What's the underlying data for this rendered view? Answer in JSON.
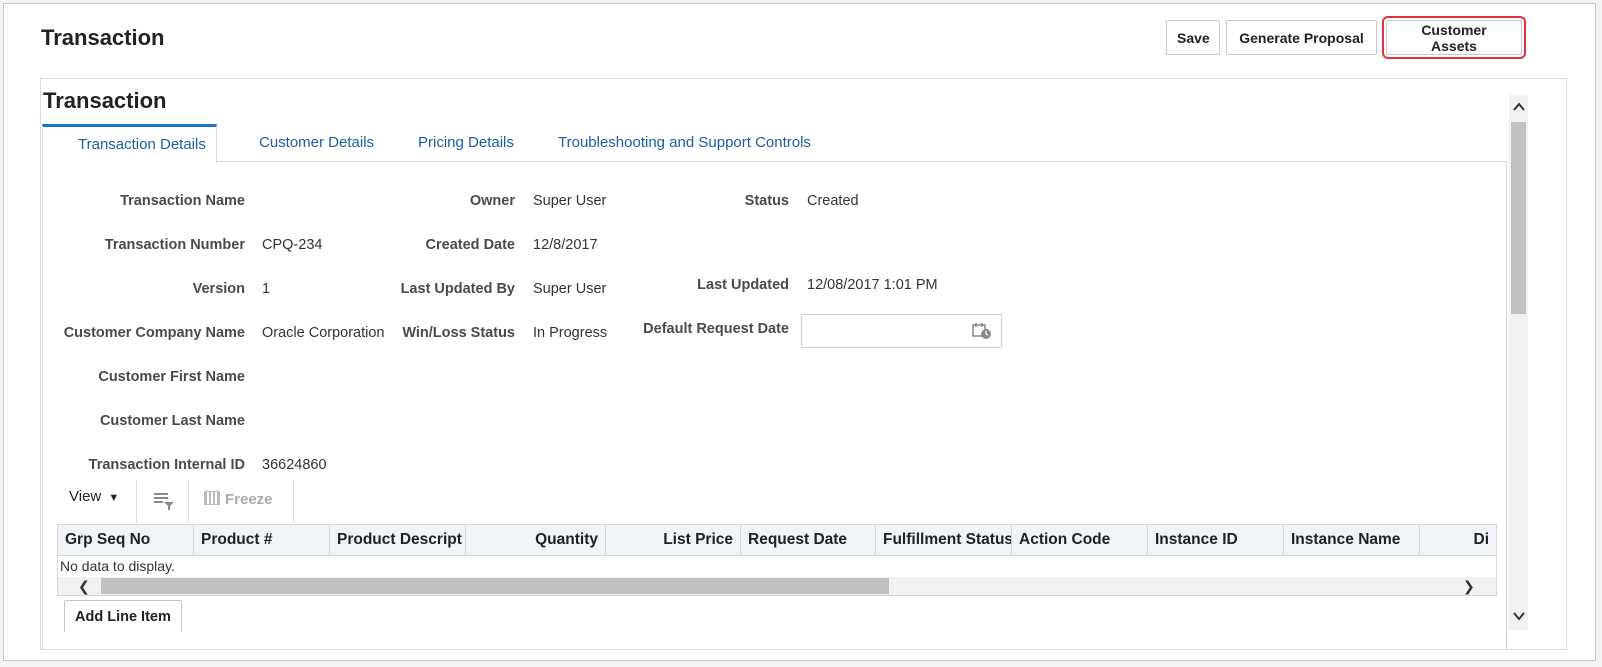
{
  "header": {
    "title": "Transaction",
    "buttons": {
      "save": "Save",
      "generate_proposal": "Generate Proposal",
      "customer_assets": "Customer Assets"
    },
    "highlight_color": "#e0343d"
  },
  "panel": {
    "title": "Transaction",
    "tabs": [
      {
        "label": "Transaction Details",
        "active": true
      },
      {
        "label": "Customer Details",
        "active": false
      },
      {
        "label": "Pricing Details",
        "active": false
      },
      {
        "label": "Troubleshooting and Support Controls",
        "active": false
      }
    ]
  },
  "fields": {
    "transaction_name": {
      "label": "Transaction Name",
      "value": ""
    },
    "transaction_number": {
      "label": "Transaction Number",
      "value": "CPQ-234"
    },
    "version": {
      "label": "Version",
      "value": "1"
    },
    "customer_company_name": {
      "label": "Customer Company Name",
      "value": "Oracle Corporation"
    },
    "customer_first_name": {
      "label": "Customer First Name",
      "value": ""
    },
    "customer_last_name": {
      "label": "Customer Last Name",
      "value": ""
    },
    "transaction_internal_id": {
      "label": "Transaction Internal ID",
      "value": "36624860"
    },
    "owner": {
      "label": "Owner",
      "value": "Super User"
    },
    "created_date": {
      "label": "Created Date",
      "value": "12/8/2017"
    },
    "last_updated_by": {
      "label": "Last Updated By",
      "value": "Super User"
    },
    "win_loss_status": {
      "label": "Win/Loss Status",
      "value": "In Progress"
    },
    "status": {
      "label": "Status",
      "value": "Created"
    },
    "last_updated": {
      "label": "Last Updated",
      "value": "12/08/2017 1:01 PM"
    },
    "default_request_date": {
      "label": "Default Request Date",
      "value": "",
      "icon": "calendar-icon"
    }
  },
  "toolbar": {
    "view": "View",
    "view_icon": "dropdown-arrow-icon",
    "filter_icon": "filter-icon",
    "freeze": "Freeze",
    "freeze_icon": "freeze-columns-icon"
  },
  "grid": {
    "columns": [
      "Grp Seq No",
      "Product #",
      "Product Descript",
      "Quantity",
      "List Price",
      "Request Date",
      "Fulfillment Status",
      "Action Code",
      "Instance ID",
      "Instance Name",
      "Di"
    ],
    "empty_text": "No data to display."
  },
  "add_line_item": "Add Line Item"
}
